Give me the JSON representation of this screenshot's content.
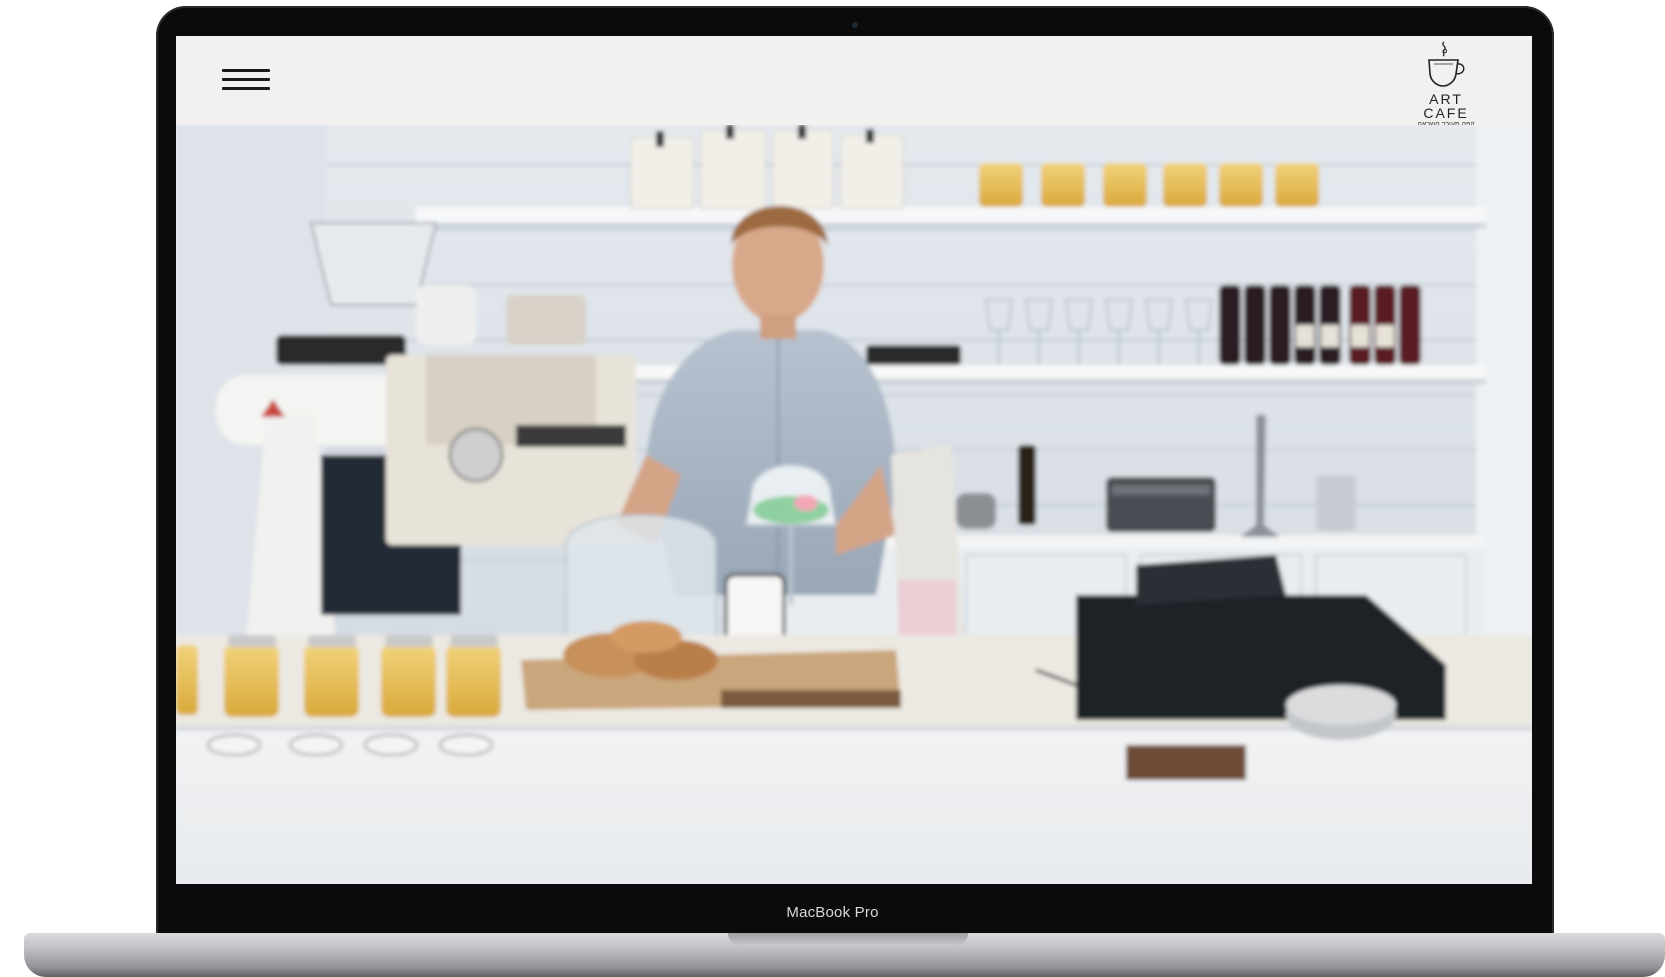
{
  "device": {
    "model_label": "MacBook Pro"
  },
  "site": {
    "header": {
      "menu_icon": "hamburger-menu-icon",
      "logo": {
        "icon": "coffee-cup-icon",
        "name": "ART CAFE",
        "tagline": "קפה מעורר השראה"
      }
    },
    "hero": {
      "image": "barista-at-cafe-counter"
    }
  },
  "colors": {
    "header_background": "#f1f1f1",
    "device_bezel": "#0b0b0b",
    "menu_icon": "#1a1a1a"
  }
}
